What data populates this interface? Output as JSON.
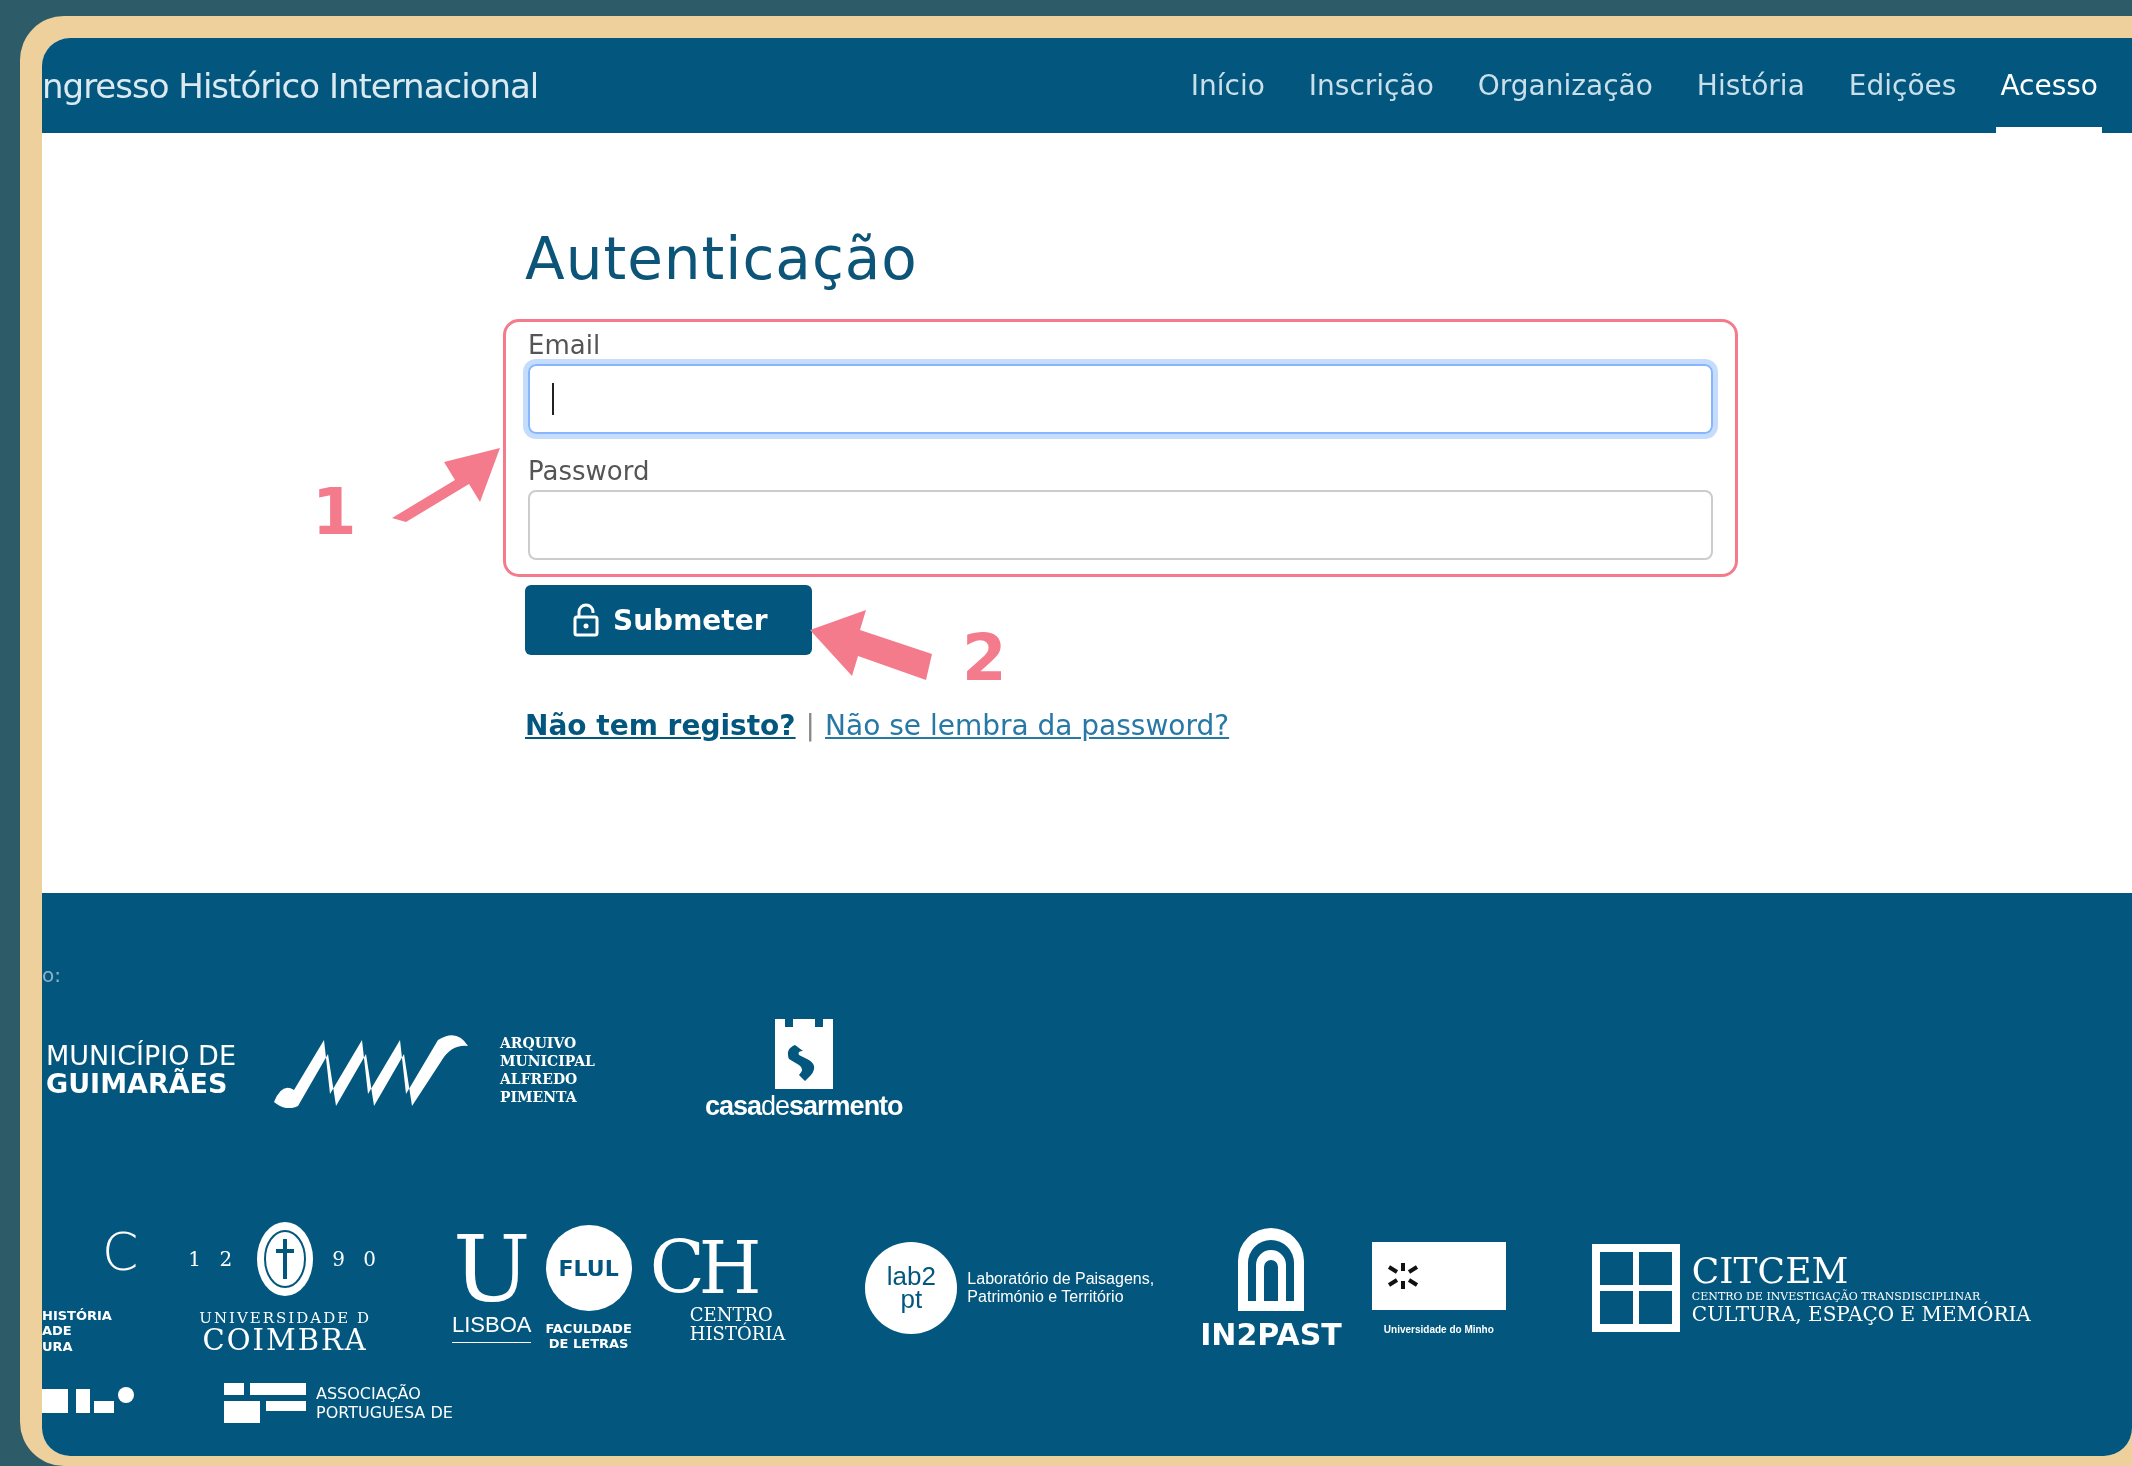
{
  "header": {
    "site_title": "ngresso Histórico Internacional",
    "nav": [
      {
        "label": "Início",
        "selected": false
      },
      {
        "label": "Inscrição",
        "selected": false
      },
      {
        "label": "Organização",
        "selected": false
      },
      {
        "label": "História",
        "selected": false
      },
      {
        "label": "Edições",
        "selected": false
      },
      {
        "label": "Acesso",
        "selected": true
      }
    ]
  },
  "login": {
    "title": "Autenticação",
    "fields": [
      {
        "label": "Email",
        "focused": true
      },
      {
        "label": "Password",
        "focused": false
      }
    ],
    "submit": "Submeter",
    "links": [
      {
        "text": "Não tem registo?",
        "bold": true
      },
      {
        "text": "Não se lembra da password?",
        "bold": false
      }
    ],
    "separator": "|"
  },
  "annotations": [
    {
      "number": "1"
    },
    {
      "number": "2"
    }
  ],
  "footer": {
    "label": "o:",
    "rows": [
      {
        "logos": [
          {
            "kind": "municipio",
            "lines": [
              "MUNICÍPIO DE",
              "GUIMARÃES"
            ]
          },
          {
            "kind": "arquivo",
            "lines": [
              "ARQUIVO",
              "MUNICIPAL",
              "ALFREDO",
              "PIMENTA"
            ]
          },
          {
            "kind": "casa",
            "lines": [
              "**casa**de**sarmento**"
            ]
          }
        ]
      },
      {
        "logos": [
          {
            "kind": "partial",
            "marks": [
              "C"
            ],
            "lines": [
              "HISTÓRIA",
              "ADE",
              "URA"
            ]
          },
          {
            "kind": "coimbra",
            "marks": [
              "1 2",
              "9 0"
            ],
            "lines": [
              "UNIVERSIDADE D",
              "COIMBRA"
            ]
          },
          {
            "kind": "ulisboa",
            "marks": [
              "U"
            ],
            "lines": [
              "LISBOA"
            ]
          },
          {
            "kind": "flul",
            "marks": [
              "FLUL"
            ],
            "lines": [
              "FACULDADE",
              "DE LETRAS"
            ]
          },
          {
            "kind": "ch",
            "marks": [
              "CH"
            ],
            "lines": [
              "CENTRO",
              "HISTÓRIA"
            ]
          },
          {
            "kind": "lab2pt",
            "marks": [
              "lab2",
              "pt"
            ],
            "lines": [
              "Laboratório de Paisagens,",
              "Património e Território"
            ]
          },
          {
            "kind": "in2past",
            "lines": [
              "IN2PAST"
            ]
          },
          {
            "kind": "uminho",
            "lines": [
              "Universidade do Minho"
            ]
          },
          {
            "kind": "citcem",
            "lines": [
              "CITCEM",
              "CENTRO DE INVESTIGAÇÃO TRANSDISCIPLINAR",
              "CULTURA, ESPAÇO E MEMÓRIA"
            ]
          }
        ]
      },
      {
        "logos": [
          {
            "kind": "partial-mark"
          },
          {
            "kind": "apm",
            "lines": [
              "ASSOCIAÇÃO",
              "PORTUGUESA DE"
            ]
          }
        ]
      }
    ]
  }
}
